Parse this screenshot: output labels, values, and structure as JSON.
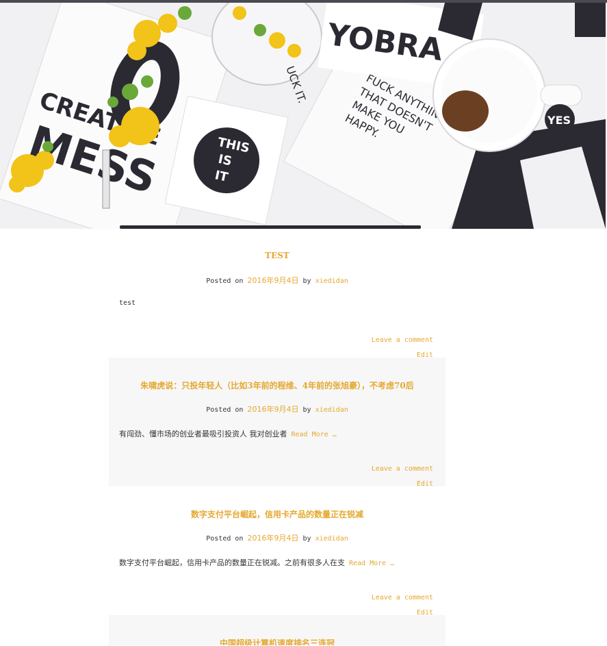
{
  "hero": {
    "texts": {
      "creative": "CREATIVE",
      "mess": "MESS",
      "this_is_it": [
        "THIS",
        "IS",
        "IT"
      ],
      "fuck_anything": [
        "FUCK ANYTHING",
        "THAT DOESN'T",
        "MAKE YOU",
        "HAPPY."
      ],
      "uck_it": "UCK IT.",
      "yobra": "YOBRA",
      "yes": "YES"
    },
    "colors": {
      "flower": "#f2c318",
      "leaf": "#6aa83a",
      "ink": "#2b2a33",
      "paper": "#f8f8f9",
      "coffee": "#6b3f22"
    }
  },
  "posts": [
    {
      "title": "TEST",
      "posted_on": "Posted on",
      "date": "2016年9月4日",
      "by": "by",
      "author": "xiedidan",
      "excerpt": "test",
      "read_more": "",
      "leave_comment": "Leave a comment",
      "edit": "Edit"
    },
    {
      "title": "朱啸虎说：只投年轻人（比如3年前的程维、4年前的张旭豪），不考虑70后",
      "posted_on": "Posted on",
      "date": "2016年9月4日",
      "by": "by",
      "author": "xiedidan",
      "excerpt": "有闯劲、懂市场的创业者最吸引投资人      我对创业者",
      "read_more": "Read More …",
      "leave_comment": "Leave a comment",
      "edit": "Edit"
    },
    {
      "title": "数字支付平台崛起，信用卡产品的数量正在锐减",
      "posted_on": "Posted on",
      "date": "2016年9月4日",
      "by": "by",
      "author": "xiedidan",
      "excerpt": "数字支付平台崛起，信用卡产品的数量正在锐减。之前有很多人在支",
      "read_more": "Read More …",
      "leave_comment": "Leave a comment",
      "edit": "Edit"
    },
    {
      "title": "中国超级计算机速度排名三连冠"
    }
  ],
  "accent_color": "#e5a830"
}
